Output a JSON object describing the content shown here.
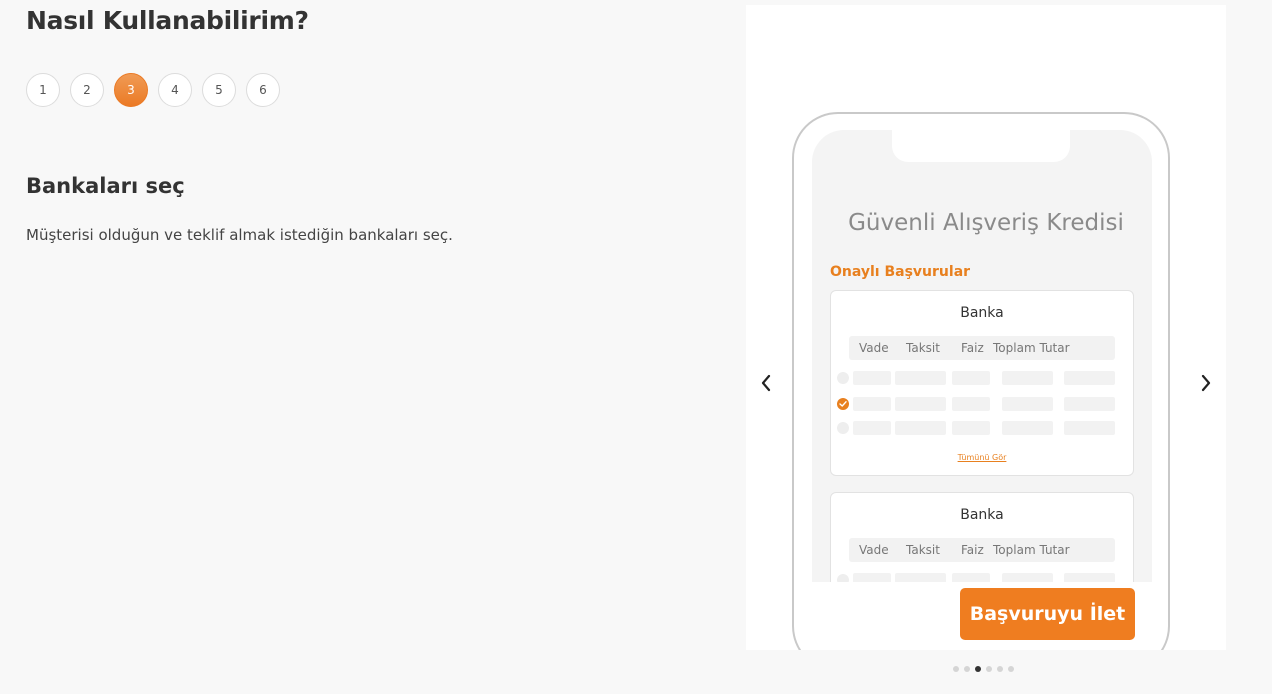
{
  "page": {
    "title": "Nasıl Kullanabilirim?",
    "steps": [
      "1",
      "2",
      "3",
      "4",
      "5",
      "6"
    ],
    "active_step_index": 2,
    "step_title": "Bankaları seç",
    "step_description": "Müşterisi olduğun ve teklif almak istediğin bankaları seç."
  },
  "slide": {
    "app_title": "Güvenli Alışveriş Kredisi",
    "section_label": "Onaylı Başvurular",
    "cards": [
      {
        "title": "Banka",
        "columns": [
          "Vade",
          "Taksit",
          "Faiz",
          "Toplam Tutar"
        ],
        "see_all": "Tümünü Gör"
      },
      {
        "title": "Banka",
        "columns": [
          "Vade",
          "Taksit",
          "Faiz",
          "Toplam Tutar"
        ]
      }
    ],
    "submit_label": "Başvuruyu İlet"
  },
  "carousel": {
    "dot_count": 6,
    "active_dot_index": 2,
    "prev_icon": "chevron-left-icon",
    "next_icon": "chevron-right-icon"
  },
  "colors": {
    "accent": "#eb7a25",
    "background": "#f8f8f8"
  }
}
